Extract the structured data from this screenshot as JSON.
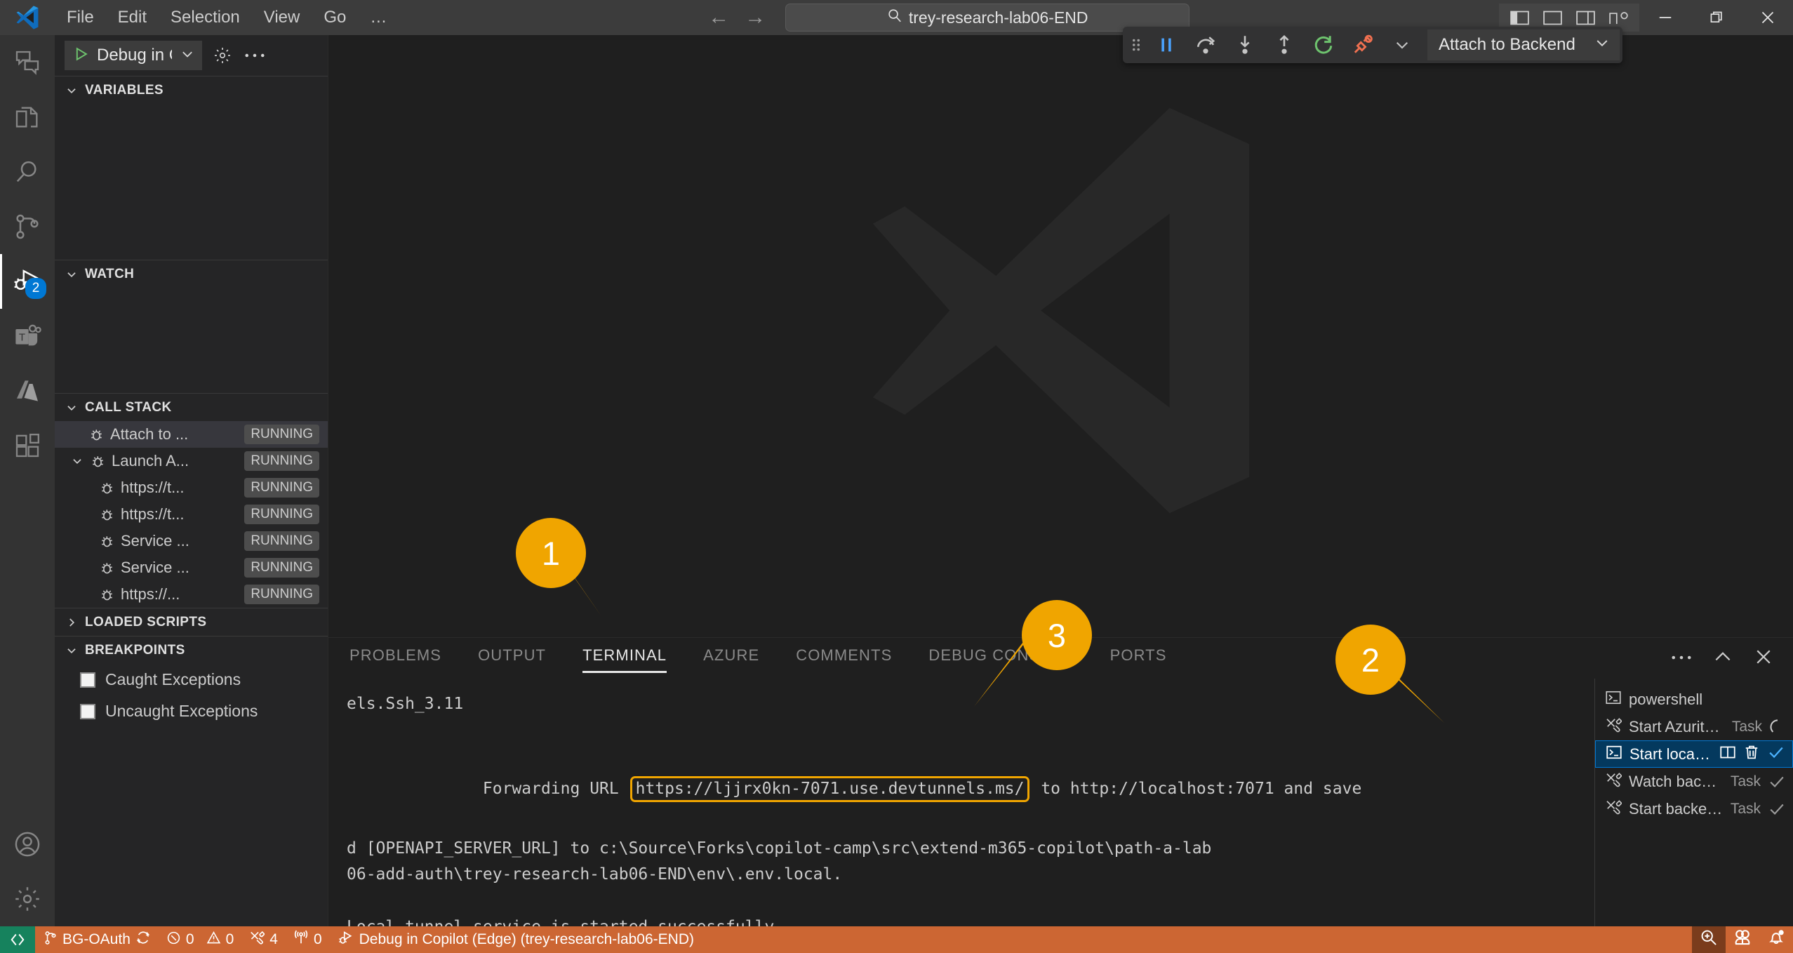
{
  "window": {
    "title_search_value": "trey-research-lab06-END",
    "menus": [
      "File",
      "Edit",
      "Selection",
      "View",
      "Go",
      "…"
    ],
    "nav_back": "←",
    "nav_forward": "→",
    "layout_buttons": [
      "toggle-primary-sidebar",
      "toggle-panel",
      "toggle-secondary-sidebar",
      "customize-layout"
    ],
    "controls": [
      "minimize",
      "restore",
      "close"
    ]
  },
  "activity_bar": {
    "items": [
      {
        "name": "chat",
        "icon": "chat-icon",
        "active": false,
        "badge": ""
      },
      {
        "name": "explorer",
        "icon": "files-icon",
        "active": false,
        "badge": ""
      },
      {
        "name": "search",
        "icon": "search-icon",
        "active": false,
        "badge": ""
      },
      {
        "name": "source-control",
        "icon": "source-control-icon",
        "active": false,
        "badge": ""
      },
      {
        "name": "run-and-debug",
        "icon": "run-debug-icon",
        "active": true,
        "badge": "2"
      },
      {
        "name": "teams-toolkit",
        "icon": "teams-icon",
        "active": false,
        "badge": ""
      },
      {
        "name": "azure",
        "icon": "azure-icon",
        "active": false,
        "badge": ""
      },
      {
        "name": "extensions",
        "icon": "extensions-icon",
        "active": false,
        "badge": ""
      }
    ],
    "bottom_items": [
      {
        "name": "accounts",
        "icon": "account-icon"
      },
      {
        "name": "manage",
        "icon": "gear-icon"
      }
    ]
  },
  "sidebar": {
    "debug_config_label": "Debug in C",
    "start_debug_icon": "play-icon",
    "config_gear_icon": "gear-icon",
    "more_icon": "ellipsis-icon",
    "panes": {
      "variables": {
        "title": "VARIABLES",
        "expanded": true
      },
      "watch": {
        "title": "WATCH",
        "expanded": true
      },
      "call_stack": {
        "title": "CALL STACK",
        "expanded": true,
        "rows": [
          {
            "label": "Attach to ...",
            "status": "RUNNING",
            "indent": 1,
            "selected": true,
            "expandable": false
          },
          {
            "label": "Launch A...",
            "status": "RUNNING",
            "indent": 1,
            "selected": false,
            "expandable": true
          },
          {
            "label": "https://t...",
            "status": "RUNNING",
            "indent": 2,
            "selected": false,
            "expandable": false
          },
          {
            "label": "https://t...",
            "status": "RUNNING",
            "indent": 2,
            "selected": false,
            "expandable": false
          },
          {
            "label": "Service ...",
            "status": "RUNNING",
            "indent": 2,
            "selected": false,
            "expandable": false
          },
          {
            "label": "Service ...",
            "status": "RUNNING",
            "indent": 2,
            "selected": false,
            "expandable": false
          },
          {
            "label": "https://...",
            "status": "RUNNING",
            "indent": 2,
            "selected": false,
            "expandable": false
          }
        ]
      },
      "loaded_scripts": {
        "title": "LOADED SCRIPTS",
        "expanded": false
      },
      "breakpoints": {
        "title": "BREAKPOINTS",
        "expanded": true,
        "items": [
          {
            "label": "Caught Exceptions",
            "checked": false
          },
          {
            "label": "Uncaught Exceptions",
            "checked": false
          }
        ]
      }
    }
  },
  "debug_toolbar": {
    "buttons": [
      {
        "name": "pause",
        "icon": "pause-icon"
      },
      {
        "name": "step-over",
        "icon": "step-over-icon"
      },
      {
        "name": "step-into",
        "icon": "step-into-icon"
      },
      {
        "name": "step-out",
        "icon": "step-out-icon"
      },
      {
        "name": "restart",
        "icon": "restart-icon"
      },
      {
        "name": "disconnect",
        "icon": "disconnect-icon"
      }
    ],
    "session_label": "Attach to Backend",
    "session_chevron": "chevron-down-icon"
  },
  "panel": {
    "tabs": [
      {
        "label": "PROBLEMS",
        "active": false
      },
      {
        "label": "OUTPUT",
        "active": false
      },
      {
        "label": "TERMINAL",
        "active": true
      },
      {
        "label": "AZURE",
        "active": false
      },
      {
        "label": "COMMENTS",
        "active": false
      },
      {
        "label": "DEBUG CONSOLE",
        "active": false
      },
      {
        "label": "PORTS",
        "active": false
      }
    ],
    "tools": [
      {
        "name": "panel-more",
        "icon": "ellipsis-icon"
      },
      {
        "name": "maximize-panel",
        "icon": "chevron-up-icon"
      },
      {
        "name": "close-panel",
        "icon": "close-icon"
      }
    ],
    "terminal": {
      "line1": "els.Ssh_3.11",
      "line2_prefix": "Forwarding URL ",
      "line2_url": "https://ljjrx0kn-7071.use.devtunnels.ms/",
      "line2_suffix": " to http://localhost:7071 and save",
      "line3": "d [OPENAPI_SERVER_URL] to c:\\Source\\Forks\\copilot-camp\\src\\extend-m365-copilot\\path-a-lab",
      "line4": "06-add-auth\\trey-research-lab06-END\\env\\.env.local.",
      "line5": "Local tunnel service is started successfully."
    },
    "terminal_list": [
      {
        "label": "powershell",
        "kind": "",
        "icon": "terminal-icon",
        "selected": false,
        "status": ""
      },
      {
        "label": "Start Azurite emulator",
        "kind": "Task",
        "icon": "tools-icon",
        "selected": false,
        "status": "spinner"
      },
      {
        "label": "Start local tunnel",
        "kind": "",
        "icon": "terminal-icon",
        "selected": true,
        "status": "check",
        "actions": [
          "split-terminal-icon",
          "trash-icon"
        ]
      },
      {
        "label": "Watch backend",
        "kind": "Task",
        "icon": "tools-icon",
        "selected": false,
        "status": "check"
      },
      {
        "label": "Start backend",
        "kind": "Task",
        "icon": "tools-icon",
        "selected": false,
        "status": "check"
      }
    ]
  },
  "status_bar": {
    "remote_icon": "remote-indicator-icon",
    "left_items": [
      {
        "name": "branch",
        "icon": "source-control-icon",
        "label": "BG-OAuth",
        "trailing_icon": "sync-icon"
      },
      {
        "name": "errors",
        "icon": "error-icon",
        "label": "0"
      },
      {
        "name": "warnings",
        "icon": "warning-icon",
        "label": "0"
      },
      {
        "name": "teams-toolkit-status",
        "icon": "tools-icon",
        "label": "4"
      },
      {
        "name": "radio-tower",
        "icon": "radio-tower-icon",
        "label": "0"
      },
      {
        "name": "debug-session",
        "icon": "debug-alt-icon",
        "label": "Debug in Copilot (Edge) (trey-research-lab06-END)"
      }
    ],
    "right_items": [
      {
        "name": "zoom-in",
        "icon": "zoom-in-icon",
        "highlighted": true
      },
      {
        "name": "live-share",
        "icon": "live-share-icon",
        "highlighted": false
      },
      {
        "name": "notifications",
        "icon": "bell-dot-icon",
        "highlighted": false
      }
    ]
  },
  "callouts": [
    {
      "number": "1",
      "target": "terminal-tab"
    },
    {
      "number": "2",
      "target": "start-local-tunnel-terminal"
    },
    {
      "number": "3",
      "target": "forwarding-url"
    }
  ],
  "colors": {
    "accent_callout": "#f0a500",
    "status_bar_debug": "#cc6633",
    "selection_blue": "#04395e",
    "badge_blue": "#0078d4",
    "remote_green": "#16825d"
  }
}
